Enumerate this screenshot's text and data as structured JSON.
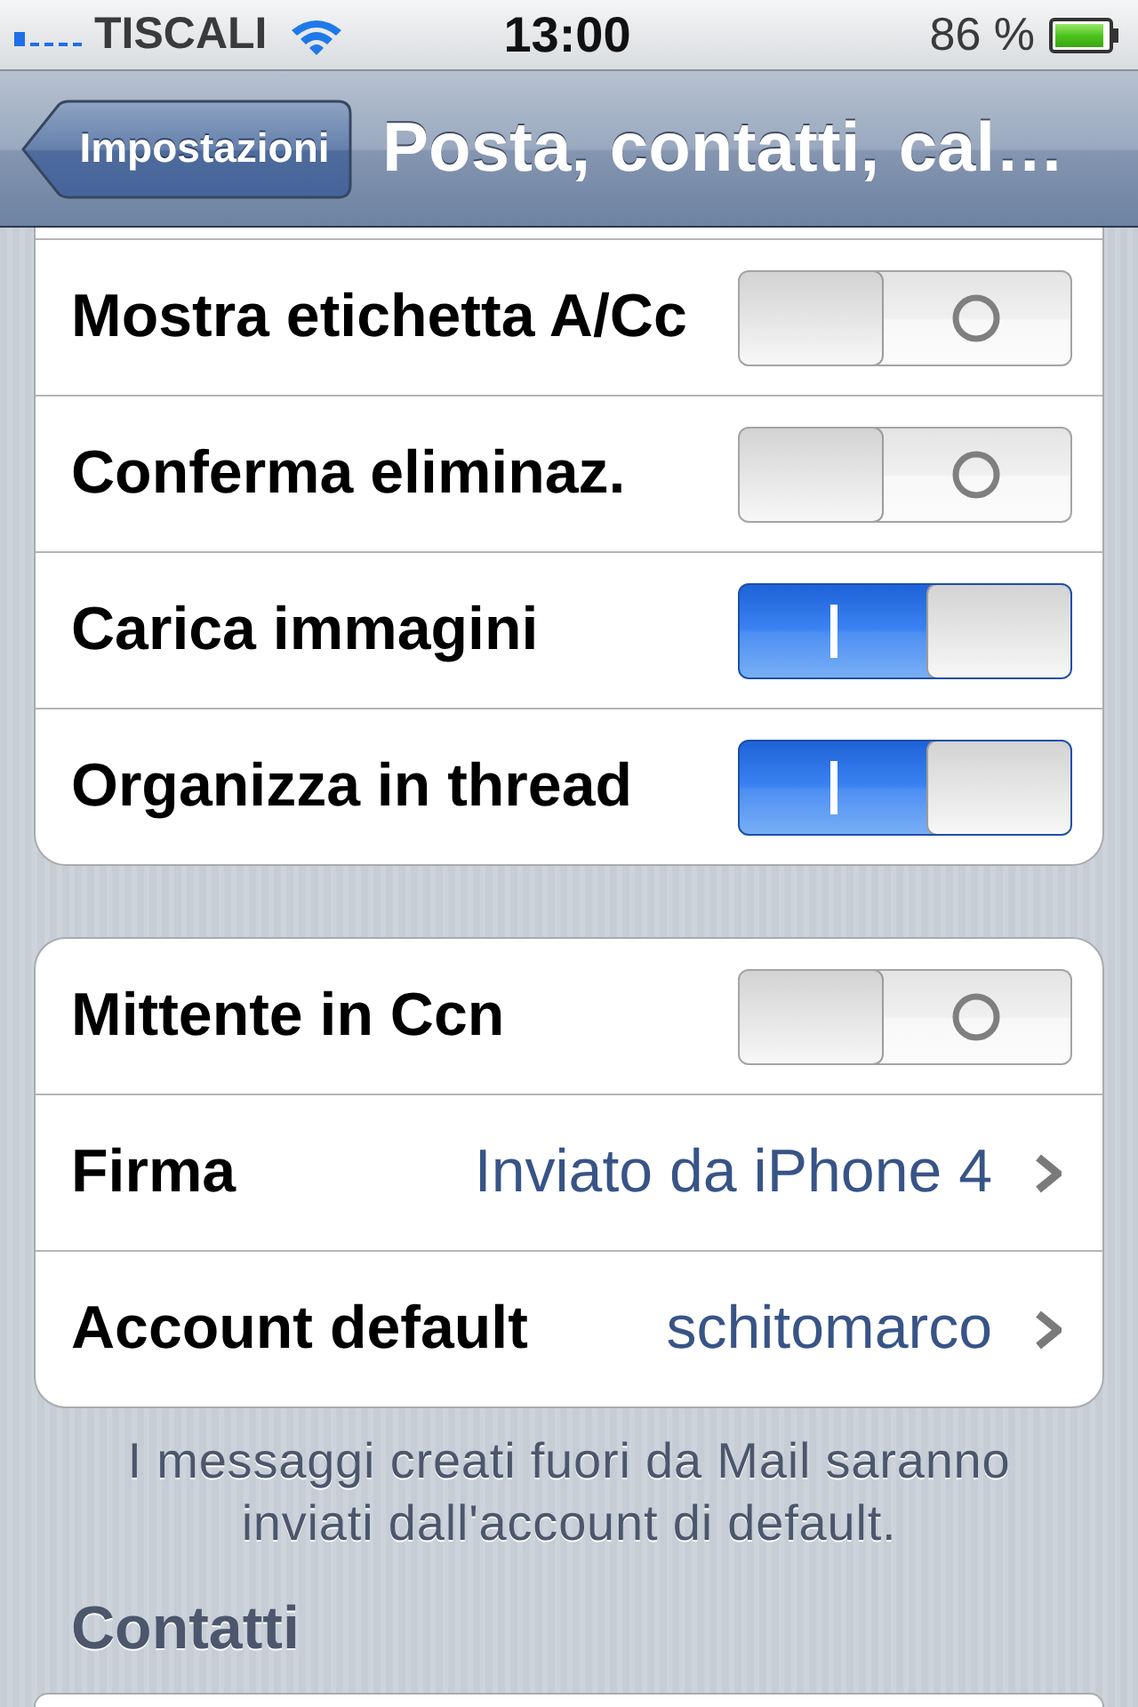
{
  "status_bar": {
    "carrier": "TISCALI",
    "time": "13:00",
    "battery": "86 %"
  },
  "nav_bar": {
    "back_button": "Impostazioni",
    "title": "Posta, contatti, cal…"
  },
  "groups": [
    {
      "rows": [
        {
          "kind": "toggle",
          "label": "Mostra etichetta A/Cc",
          "on": false
        },
        {
          "kind": "toggle",
          "label": "Conferma eliminaz.",
          "on": false
        },
        {
          "kind": "toggle",
          "label": "Carica immagini",
          "on": true
        },
        {
          "kind": "toggle",
          "label": "Organizza in thread",
          "on": true
        }
      ]
    },
    {
      "rows": [
        {
          "kind": "toggle",
          "label": "Mittente in Ccn",
          "on": false
        },
        {
          "kind": "disclosure",
          "label": "Firma",
          "value": "Inviato da iPhone 4"
        },
        {
          "kind": "disclosure",
          "label": "Account default",
          "value": "schitomarco"
        }
      ],
      "footer": "I messaggi creati fuori da Mail saranno inviati dall'account di default."
    }
  ],
  "sections": [
    {
      "header": "Contatti"
    }
  ]
}
